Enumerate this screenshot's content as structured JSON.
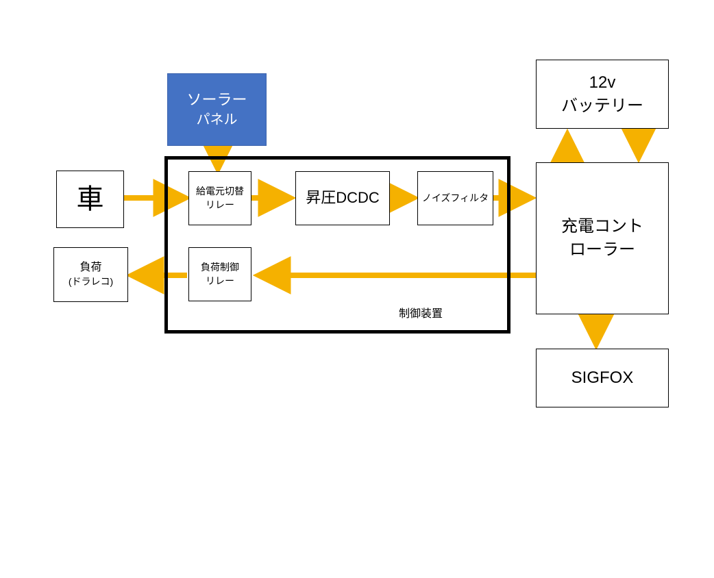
{
  "blocks": {
    "solar": {
      "line1": "ソーラー",
      "line2": "パネル"
    },
    "car": {
      "line1": "車"
    },
    "load": {
      "line1": "負荷",
      "line2": "(ドラレコ)"
    },
    "battery": {
      "line1": "12v",
      "line2": "バッテリー"
    },
    "charge_ctrl": {
      "line1": "充電コント",
      "line2": "ローラー"
    },
    "sigfox": {
      "line1": "SIGFOX"
    },
    "ctrl_unit_label": "制御装置",
    "relay_src": {
      "line1": "給電元切替",
      "line2": "リレー"
    },
    "dcdc": {
      "line1": "昇圧DCDC"
    },
    "noise_filter": {
      "line1": "ノイズフィルタ"
    },
    "relay_load": {
      "line1": "負荷制御",
      "line2": "リレー"
    }
  },
  "colors": {
    "arrow": "#f5b100",
    "solar_fill": "#4472c4"
  }
}
